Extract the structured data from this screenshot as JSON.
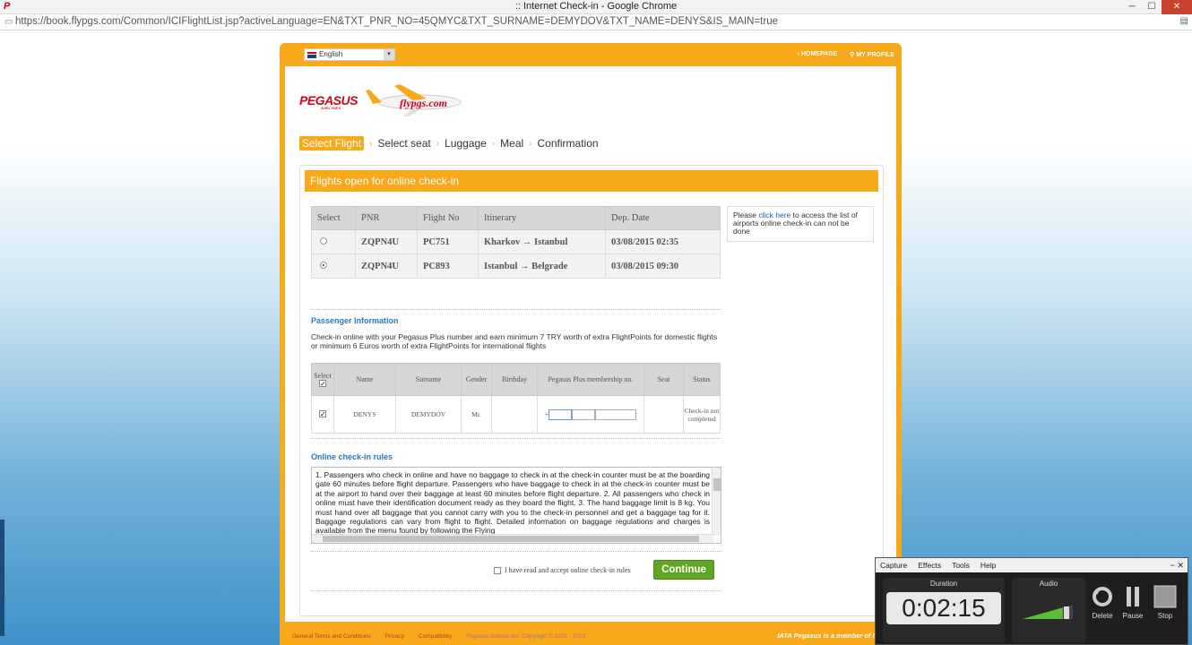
{
  "browser": {
    "title": ":: Internet Check-in - Google Chrome",
    "url": "https://book.flypgs.com/Common/ICIFlightList.jsp?activeLanguage=EN&TXT_PNR_NO=45QMYC&TXT_SURNAME=DEMYDOV&TXT_NAME=DENYS&IS_MAIN=true"
  },
  "topbar": {
    "language": "English",
    "homepage": "HOMEPAGE",
    "myprofile": "MY PROFILE"
  },
  "logo": {
    "brand": "PEGASUS",
    "sub": "AIRLINES",
    "plane_text": "flypgs.com"
  },
  "steps": [
    "Select Flight",
    "Select seat",
    "Luggage",
    "Meal",
    "Confirmation"
  ],
  "panel_title": "Flights open for online check-in",
  "flights": {
    "headers": [
      "Select",
      "PNR",
      "Flight No",
      "Itinerary",
      "Dep. Date"
    ],
    "rows": [
      {
        "pnr": "ZQPN4U",
        "flight": "PC751",
        "itinerary": "Kharkov → Istanbul",
        "date": "03/08/2015 02:35",
        "selected": false
      },
      {
        "pnr": "ZQPN4U",
        "flight": "PC893",
        "itinerary": "Istanbul → Belgrade",
        "date": "03/08/2015 09:30",
        "selected": true
      }
    ]
  },
  "info": {
    "pre": "Please ",
    "link": "click here",
    "post": " to access the list of airports online check-in can not be done"
  },
  "passenger": {
    "title": "Passenger Information",
    "text": "Check-in online with your Pegasus Plus number and earn minimum 7 TRY worth of extra FlightPoints for domestic flights or minimum 6 Euros worth of extra FlightPoints for international flights",
    "headers": [
      "Select",
      "Name",
      "Surname",
      "Gender",
      "Birthday",
      "Pegasus Plus membership no.",
      "Seat",
      "Status"
    ],
    "row": {
      "name": "DENYS",
      "surname": "DEMYDOV",
      "gender": "Mr.",
      "birthday": "",
      "plus_prefix": "+",
      "seat": "",
      "status": "Check-in not completed"
    }
  },
  "rules": {
    "title": "Online check-in rules",
    "text": "1. Passengers who check in online and have no baggage to check in at the check-in counter must be at the boarding gate 60 minutes before flight departure. Passengers who have baggage to check in at the check-in counter must be at the airport to hand over their baggage at least 60 minutes before flight departure. 2. All passengers who check in online must have their identification document ready as they board the flight. 3. The hand baggage limit is 8 kg. You must hand over all baggage that you cannot carry with you to the check-in personnel and get a baggage tag for it. Baggage regulations can vary from flight to flight. Detailed information on baggage regulations and charges is available from the menu found by following the Flying"
  },
  "accept_label": "I have read and accept online check-in rules",
  "continue_label": "Continue",
  "footer": {
    "links": [
      "General Terms and Conditions",
      "Privacy",
      "Compatibility"
    ],
    "copyright": "Pegasus Airlines Inc. Copyright © 2005 - 2013",
    "iata_text": "Pegasus is a member of IATA",
    "iata_logo": "IATA"
  },
  "recorder": {
    "menu": [
      "Capture",
      "Effects",
      "Tools",
      "Help"
    ],
    "duration_label": "Duration",
    "time": "0:02:15",
    "audio_label": "Audio",
    "audio_level": 0.8,
    "controls": [
      "Delete",
      "Pause",
      "Stop"
    ]
  },
  "colors": {
    "brand_orange": "#f7a81b",
    "brand_red": "#d0021b",
    "continue_green": "#5fa624"
  }
}
